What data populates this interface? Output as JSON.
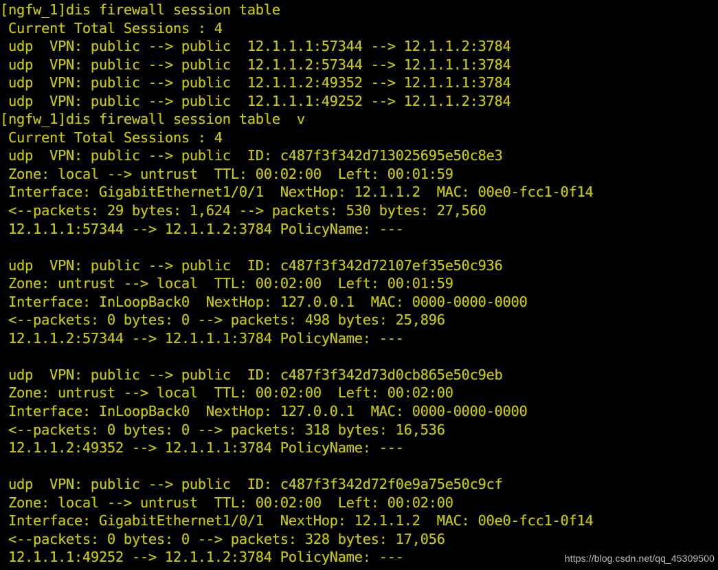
{
  "terminal": {
    "background_color": "#000000",
    "text_color": "#c8c800",
    "watermark_color": "#cfcfcf",
    "watermark": "https://blog.csdn.net/qq_45309500"
  },
  "console": {
    "lines": [
      "[ngfw_1]dis firewall session table",
      " Current Total Sessions : 4",
      " udp  VPN: public --> public  12.1.1.1:57344 --> 12.1.1.2:3784",
      " udp  VPN: public --> public  12.1.1.2:57344 --> 12.1.1.1:3784",
      " udp  VPN: public --> public  12.1.1.2:49352 --> 12.1.1.1:3784",
      " udp  VPN: public --> public  12.1.1.1:49252 --> 12.1.1.2:3784",
      "[ngfw_1]dis firewall session table  v",
      " Current Total Sessions : 4",
      " udp  VPN: public --> public  ID: c487f3f342d713025695e50c8e3",
      " Zone: local --> untrust  TTL: 00:02:00  Left: 00:01:59",
      " Interface: GigabitEthernet1/0/1  NextHop: 12.1.1.2  MAC: 00e0-fcc1-0f14",
      " <--packets: 29 bytes: 1,624 --> packets: 530 bytes: 27,560",
      " 12.1.1.1:57344 --> 12.1.1.2:3784 PolicyName: ---",
      "",
      " udp  VPN: public --> public  ID: c487f3f342d72107ef35e50c936",
      " Zone: untrust --> local  TTL: 00:02:00  Left: 00:01:59",
      " Interface: InLoopBack0  NextHop: 127.0.0.1  MAC: 0000-0000-0000",
      " <--packets: 0 bytes: 0 --> packets: 498 bytes: 25,896",
      " 12.1.1.2:57344 --> 12.1.1.1:3784 PolicyName: ---",
      "",
      " udp  VPN: public --> public  ID: c487f3f342d73d0cb865e50c9eb",
      " Zone: untrust --> local  TTL: 00:02:00  Left: 00:02:00",
      " Interface: InLoopBack0  NextHop: 127.0.0.1  MAC: 0000-0000-0000",
      " <--packets: 0 bytes: 0 --> packets: 318 bytes: 16,536",
      " 12.1.1.2:49352 --> 12.1.1.1:3784 PolicyName: ---",
      "",
      " udp  VPN: public --> public  ID: c487f3f342d72f0e9a75e50c9cf",
      " Zone: local --> untrust  TTL: 00:02:00  Left: 00:02:00",
      " Interface: GigabitEthernet1/0/1  NextHop: 12.1.1.2  MAC: 00e0-fcc1-0f14",
      " <--packets: 0 bytes: 0 --> packets: 328 bytes: 17,056",
      " 12.1.1.1:49252 --> 12.1.1.2:3784 PolicyName: ---"
    ]
  },
  "commands": [
    {
      "prompt": "[ngfw_1]",
      "command": "dis firewall session table",
      "total_sessions": "4",
      "sessions": [
        {
          "protocol": "udp",
          "vpn": "VPN: public --> public",
          "source": "12.1.1.1:57344",
          "destination": "12.1.1.2:3784"
        },
        {
          "protocol": "udp",
          "vpn": "VPN: public --> public",
          "source": "12.1.1.2:57344",
          "destination": "12.1.1.1:3784"
        },
        {
          "protocol": "udp",
          "vpn": "VPN: public --> public",
          "source": "12.1.1.2:49352",
          "destination": "12.1.1.1:3784"
        },
        {
          "protocol": "udp",
          "vpn": "VPN: public --> public",
          "source": "12.1.1.1:49252",
          "destination": "12.1.1.2:3784"
        }
      ]
    },
    {
      "prompt": "[ngfw_1]",
      "command": "dis firewall session table  v",
      "total_sessions": "4",
      "sessions": [
        {
          "protocol": "udp",
          "vpn": "VPN: public --> public",
          "id": "c487f3f342d713025695e50c8e3",
          "zone": "local --> untrust",
          "ttl": "00:02:00",
          "left": "00:01:59",
          "interface": "GigabitEthernet1/0/1",
          "next_hop": "12.1.1.2",
          "mac": "00e0-fcc1-0f14",
          "in_packets": "29",
          "in_bytes": "1,624",
          "out_packets": "530",
          "out_bytes": "27,560",
          "flow": "12.1.1.1:57344 --> 12.1.1.2:3784",
          "policy_name": "---"
        },
        {
          "protocol": "udp",
          "vpn": "VPN: public --> public",
          "id": "c487f3f342d72107ef35e50c936",
          "zone": "untrust --> local",
          "ttl": "00:02:00",
          "left": "00:01:59",
          "interface": "InLoopBack0",
          "next_hop": "127.0.0.1",
          "mac": "0000-0000-0000",
          "in_packets": "0",
          "in_bytes": "0",
          "out_packets": "498",
          "out_bytes": "25,896",
          "flow": "12.1.1.2:57344 --> 12.1.1.1:3784",
          "policy_name": "---"
        },
        {
          "protocol": "udp",
          "vpn": "VPN: public --> public",
          "id": "c487f3f342d73d0cb865e50c9eb",
          "zone": "untrust --> local",
          "ttl": "00:02:00",
          "left": "00:02:00",
          "interface": "InLoopBack0",
          "next_hop": "127.0.0.1",
          "mac": "0000-0000-0000",
          "in_packets": "0",
          "in_bytes": "0",
          "out_packets": "318",
          "out_bytes": "16,536",
          "flow": "12.1.1.2:49352 --> 12.1.1.1:3784",
          "policy_name": "---"
        },
        {
          "protocol": "udp",
          "vpn": "VPN: public --> public",
          "id": "c487f3f342d72f0e9a75e50c9cf",
          "zone": "local --> untrust",
          "ttl": "00:02:00",
          "left": "00:02:00",
          "interface": "GigabitEthernet1/0/1",
          "next_hop": "12.1.1.2",
          "mac": "00e0-fcc1-0f14",
          "in_packets": "0",
          "in_bytes": "0",
          "out_packets": "328",
          "out_bytes": "17,056",
          "flow": "12.1.1.1:49252 --> 12.1.1.2:3784",
          "policy_name": "---"
        }
      ]
    }
  ]
}
